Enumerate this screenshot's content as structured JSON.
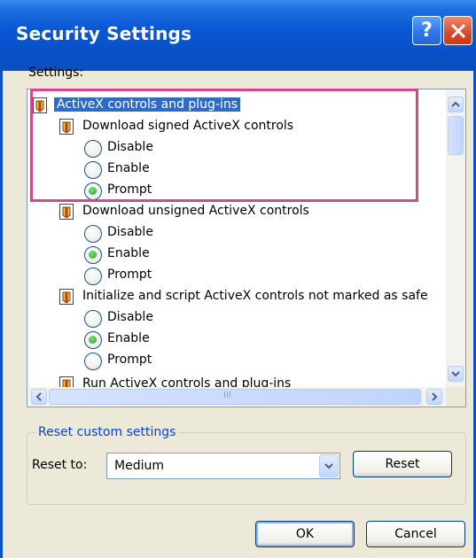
{
  "window": {
    "title": "Security Settings",
    "help_glyph": "?",
    "close_icon": "close-icon"
  },
  "settings_label": "Settings:",
  "tree": {
    "category": "ActiveX controls and plug-ins",
    "items": [
      {
        "label": "Download signed ActiveX controls",
        "options": [
          "Disable",
          "Enable",
          "Prompt"
        ],
        "selected": "Prompt"
      },
      {
        "label": "Download unsigned ActiveX controls",
        "options": [
          "Disable",
          "Enable",
          "Prompt"
        ],
        "selected": "Enable"
      },
      {
        "label": "Initialize and script ActiveX controls not marked as safe",
        "options": [
          "Disable",
          "Enable",
          "Prompt"
        ],
        "selected": "Enable"
      },
      {
        "label": "Run ActiveX controls and plug-ins"
      }
    ],
    "hscroll_grip": "III"
  },
  "reset_group": {
    "title": "Reset custom settings",
    "reset_to_label": "Reset to:",
    "level_value": "Medium",
    "reset_button": "Reset"
  },
  "footer": {
    "ok": "OK",
    "cancel": "Cancel"
  },
  "colors": {
    "title_bar": "#0a58d6",
    "selection": "#316ac5",
    "highlight_box": "#d34a8c",
    "radio_selected": "#21a121",
    "group_title": "#0046d5"
  }
}
